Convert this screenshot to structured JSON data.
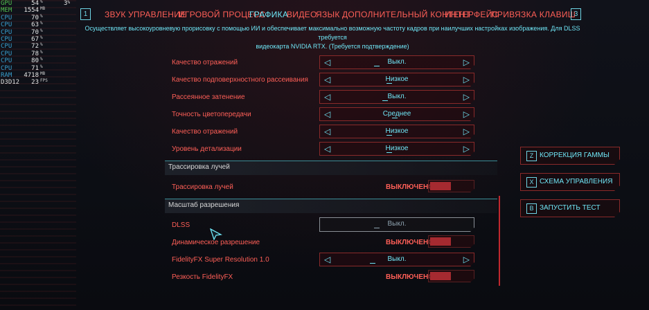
{
  "overlay": {
    "rows": [
      {
        "label": "GPU",
        "value": "54",
        "unit": "%",
        "color": "green"
      },
      {
        "label": "MEM",
        "value": "1554",
        "unit": "MB",
        "color": "green"
      },
      {
        "label": "CPU",
        "value": "70",
        "unit": "%",
        "color": "blue"
      },
      {
        "label": "CPU",
        "value": "63",
        "unit": "%",
        "color": "blue"
      },
      {
        "label": "CPU",
        "value": "70",
        "unit": "%",
        "color": "blue"
      },
      {
        "label": "CPU",
        "value": "67",
        "unit": "%",
        "color": "blue"
      },
      {
        "label": "CPU",
        "value": "72",
        "unit": "%",
        "color": "blue"
      },
      {
        "label": "CPU",
        "value": "78",
        "unit": "%",
        "color": "blue"
      },
      {
        "label": "CPU",
        "value": "80",
        "unit": "%",
        "color": "blue"
      },
      {
        "label": "CPU",
        "value": "71",
        "unit": "%",
        "color": "blue"
      },
      {
        "label": "RAM",
        "value": "4718",
        "unit": "MB",
        "color": "blue"
      },
      {
        "label": "D3D12",
        "value": "23",
        "unit": "FPS",
        "color": "white"
      }
    ],
    "extra_value": "3",
    "extra_unit": "%"
  },
  "nav": {
    "left_key": "1",
    "right_key": "3",
    "tabs": [
      {
        "label": "Звук",
        "active": false
      },
      {
        "label": "Управление",
        "active": false
      },
      {
        "label": "Игровой процесс",
        "active": false
      },
      {
        "label": "Графика",
        "active": true
      },
      {
        "label": "Видео",
        "active": false
      },
      {
        "label": "Язык",
        "active": false
      },
      {
        "label": "Дополнительный контент",
        "active": false
      },
      {
        "label": "Интерфейс",
        "active": false
      },
      {
        "label": "Привязка клавиш",
        "active": false
      }
    ]
  },
  "description": {
    "line1": "Осуществляет высокоуровневую прорисовку с помощью ИИ и обеспечивает максимально возможную частоту кадров при наилучших настройках изображения. Для DLSS требуется",
    "line2": "видеокарта NVIDIA RTX. (Требуется подтверждение)"
  },
  "settings": [
    {
      "label": "Качество отражений",
      "value": "Выкл."
    },
    {
      "label": "Качество подповерхностного рассеивания",
      "value": "Низкое"
    },
    {
      "label": "Рассеянное затенение",
      "value": "Выкл."
    },
    {
      "label": "Точность цветопередачи",
      "value": "Среднее"
    },
    {
      "label": "Качество отражений",
      "value": "Низкое"
    },
    {
      "label": "Уровень детализации",
      "value": "Низкое"
    }
  ],
  "raytracing": {
    "header": "Трассировка лучей",
    "label": "Трассировка лучей",
    "state": "ВЫКЛЮЧЕНО"
  },
  "resolution": {
    "header": "Масштаб разрешения",
    "dlss_label": "DLSS",
    "dlss_value": "Выкл.",
    "dynamic_label": "Динамическое разрешение",
    "dynamic_state": "ВЫКЛЮЧЕНО",
    "fsr_label": "FidelityFX Super Resolution 1.0",
    "fsr_value": "Выкл.",
    "sharp_label": "Резкость FidelityFX",
    "sharp_state": "ВЫКЛЮЧЕНО"
  },
  "side_buttons": [
    {
      "key": "Z",
      "label": "КОРРЕКЦИЯ ГАММЫ"
    },
    {
      "key": "X",
      "label": "СХЕМА УПРАВЛЕНИЯ"
    },
    {
      "key": "B",
      "label": "ЗАПУСТИТЬ ТЕСТ"
    }
  ],
  "colors": {
    "accent_red": "#ff5f57",
    "accent_cyan": "#6fe6f6",
    "background": "#0b0d13"
  }
}
